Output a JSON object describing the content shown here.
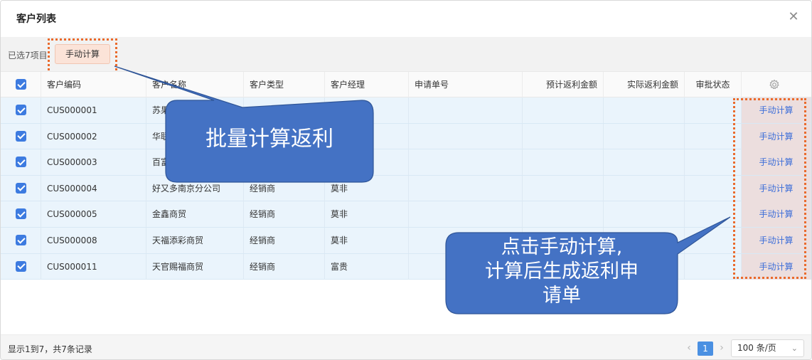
{
  "window": {
    "title": "客户列表",
    "close_symbol": "✕"
  },
  "toolbar": {
    "selected_text": "已选7项目",
    "batch_button_label": "手动计算"
  },
  "table": {
    "columns": [
      "客户编码",
      "客户名称",
      "客户类型",
      "客户经理",
      "申请单号",
      "预计返利金额",
      "实际返利金额",
      "审批状态"
    ],
    "rows": [
      {
        "code": "CUS000001",
        "name": "苏果",
        "type": "",
        "manager": "",
        "op": "手动计算"
      },
      {
        "code": "CUS000002",
        "name": "华联",
        "type": "",
        "manager": "",
        "op": "手动计算"
      },
      {
        "code": "CUS000003",
        "name": "百富",
        "type": "",
        "manager": "",
        "op": "手动计算"
      },
      {
        "code": "CUS000004",
        "name": "好又多南京分公司",
        "type": "经销商",
        "manager": "莫非",
        "op": "手动计算"
      },
      {
        "code": "CUS000005",
        "name": "金鑫商贸",
        "type": "经销商",
        "manager": "莫非",
        "op": "手动计算"
      },
      {
        "code": "CUS000008",
        "name": "天福添彩商贸",
        "type": "经销商",
        "manager": "莫非",
        "op": "手动计算"
      },
      {
        "code": "CUS000011",
        "name": "天官赐福商贸",
        "type": "经销商",
        "manager": "富贵",
        "op": "手动计算"
      }
    ]
  },
  "footer": {
    "summary": "显示1到7，共7条记录",
    "prev_symbol": "‹",
    "next_symbol": "›",
    "current_page": "1",
    "page_size": "100 条/页",
    "caret_symbol": "⌄"
  },
  "callouts": {
    "batch": "批量计算返利",
    "single_line1": "点击手动计算,",
    "single_line2": "计算后生成返利申",
    "single_line3": "请单"
  },
  "icons": {
    "settings": "gear-icon",
    "checkbox": "checkbox-checked-icon"
  },
  "colors": {
    "accent": "#3d7be0",
    "callout_fill": "#4472c4",
    "highlight_border": "#ea6a2c",
    "row_selected": "#eaf4fc"
  }
}
